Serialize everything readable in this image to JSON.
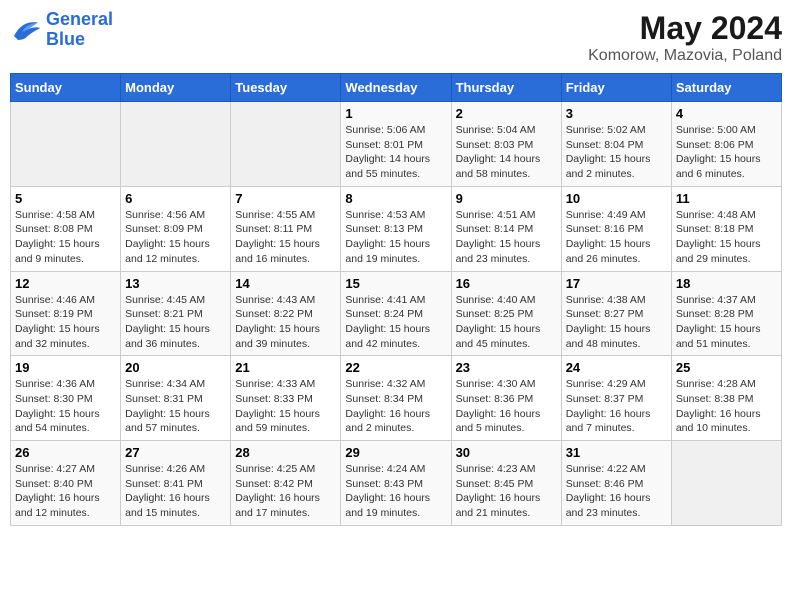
{
  "logo": {
    "line1": "General",
    "line2": "Blue"
  },
  "title": "May 2024",
  "subtitle": "Komorow, Mazovia, Poland",
  "headers": [
    "Sunday",
    "Monday",
    "Tuesday",
    "Wednesday",
    "Thursday",
    "Friday",
    "Saturday"
  ],
  "weeks": [
    [
      {
        "day": "",
        "sunrise": "",
        "sunset": "",
        "daylight": ""
      },
      {
        "day": "",
        "sunrise": "",
        "sunset": "",
        "daylight": ""
      },
      {
        "day": "",
        "sunrise": "",
        "sunset": "",
        "daylight": ""
      },
      {
        "day": "1",
        "sunrise": "Sunrise: 5:06 AM",
        "sunset": "Sunset: 8:01 PM",
        "daylight": "Daylight: 14 hours and 55 minutes."
      },
      {
        "day": "2",
        "sunrise": "Sunrise: 5:04 AM",
        "sunset": "Sunset: 8:03 PM",
        "daylight": "Daylight: 14 hours and 58 minutes."
      },
      {
        "day": "3",
        "sunrise": "Sunrise: 5:02 AM",
        "sunset": "Sunset: 8:04 PM",
        "daylight": "Daylight: 15 hours and 2 minutes."
      },
      {
        "day": "4",
        "sunrise": "Sunrise: 5:00 AM",
        "sunset": "Sunset: 8:06 PM",
        "daylight": "Daylight: 15 hours and 6 minutes."
      }
    ],
    [
      {
        "day": "5",
        "sunrise": "Sunrise: 4:58 AM",
        "sunset": "Sunset: 8:08 PM",
        "daylight": "Daylight: 15 hours and 9 minutes."
      },
      {
        "day": "6",
        "sunrise": "Sunrise: 4:56 AM",
        "sunset": "Sunset: 8:09 PM",
        "daylight": "Daylight: 15 hours and 12 minutes."
      },
      {
        "day": "7",
        "sunrise": "Sunrise: 4:55 AM",
        "sunset": "Sunset: 8:11 PM",
        "daylight": "Daylight: 15 hours and 16 minutes."
      },
      {
        "day": "8",
        "sunrise": "Sunrise: 4:53 AM",
        "sunset": "Sunset: 8:13 PM",
        "daylight": "Daylight: 15 hours and 19 minutes."
      },
      {
        "day": "9",
        "sunrise": "Sunrise: 4:51 AM",
        "sunset": "Sunset: 8:14 PM",
        "daylight": "Daylight: 15 hours and 23 minutes."
      },
      {
        "day": "10",
        "sunrise": "Sunrise: 4:49 AM",
        "sunset": "Sunset: 8:16 PM",
        "daylight": "Daylight: 15 hours and 26 minutes."
      },
      {
        "day": "11",
        "sunrise": "Sunrise: 4:48 AM",
        "sunset": "Sunset: 8:18 PM",
        "daylight": "Daylight: 15 hours and 29 minutes."
      }
    ],
    [
      {
        "day": "12",
        "sunrise": "Sunrise: 4:46 AM",
        "sunset": "Sunset: 8:19 PM",
        "daylight": "Daylight: 15 hours and 32 minutes."
      },
      {
        "day": "13",
        "sunrise": "Sunrise: 4:45 AM",
        "sunset": "Sunset: 8:21 PM",
        "daylight": "Daylight: 15 hours and 36 minutes."
      },
      {
        "day": "14",
        "sunrise": "Sunrise: 4:43 AM",
        "sunset": "Sunset: 8:22 PM",
        "daylight": "Daylight: 15 hours and 39 minutes."
      },
      {
        "day": "15",
        "sunrise": "Sunrise: 4:41 AM",
        "sunset": "Sunset: 8:24 PM",
        "daylight": "Daylight: 15 hours and 42 minutes."
      },
      {
        "day": "16",
        "sunrise": "Sunrise: 4:40 AM",
        "sunset": "Sunset: 8:25 PM",
        "daylight": "Daylight: 15 hours and 45 minutes."
      },
      {
        "day": "17",
        "sunrise": "Sunrise: 4:38 AM",
        "sunset": "Sunset: 8:27 PM",
        "daylight": "Daylight: 15 hours and 48 minutes."
      },
      {
        "day": "18",
        "sunrise": "Sunrise: 4:37 AM",
        "sunset": "Sunset: 8:28 PM",
        "daylight": "Daylight: 15 hours and 51 minutes."
      }
    ],
    [
      {
        "day": "19",
        "sunrise": "Sunrise: 4:36 AM",
        "sunset": "Sunset: 8:30 PM",
        "daylight": "Daylight: 15 hours and 54 minutes."
      },
      {
        "day": "20",
        "sunrise": "Sunrise: 4:34 AM",
        "sunset": "Sunset: 8:31 PM",
        "daylight": "Daylight: 15 hours and 57 minutes."
      },
      {
        "day": "21",
        "sunrise": "Sunrise: 4:33 AM",
        "sunset": "Sunset: 8:33 PM",
        "daylight": "Daylight: 15 hours and 59 minutes."
      },
      {
        "day": "22",
        "sunrise": "Sunrise: 4:32 AM",
        "sunset": "Sunset: 8:34 PM",
        "daylight": "Daylight: 16 hours and 2 minutes."
      },
      {
        "day": "23",
        "sunrise": "Sunrise: 4:30 AM",
        "sunset": "Sunset: 8:36 PM",
        "daylight": "Daylight: 16 hours and 5 minutes."
      },
      {
        "day": "24",
        "sunrise": "Sunrise: 4:29 AM",
        "sunset": "Sunset: 8:37 PM",
        "daylight": "Daylight: 16 hours and 7 minutes."
      },
      {
        "day": "25",
        "sunrise": "Sunrise: 4:28 AM",
        "sunset": "Sunset: 8:38 PM",
        "daylight": "Daylight: 16 hours and 10 minutes."
      }
    ],
    [
      {
        "day": "26",
        "sunrise": "Sunrise: 4:27 AM",
        "sunset": "Sunset: 8:40 PM",
        "daylight": "Daylight: 16 hours and 12 minutes."
      },
      {
        "day": "27",
        "sunrise": "Sunrise: 4:26 AM",
        "sunset": "Sunset: 8:41 PM",
        "daylight": "Daylight: 16 hours and 15 minutes."
      },
      {
        "day": "28",
        "sunrise": "Sunrise: 4:25 AM",
        "sunset": "Sunset: 8:42 PM",
        "daylight": "Daylight: 16 hours and 17 minutes."
      },
      {
        "day": "29",
        "sunrise": "Sunrise: 4:24 AM",
        "sunset": "Sunset: 8:43 PM",
        "daylight": "Daylight: 16 hours and 19 minutes."
      },
      {
        "day": "30",
        "sunrise": "Sunrise: 4:23 AM",
        "sunset": "Sunset: 8:45 PM",
        "daylight": "Daylight: 16 hours and 21 minutes."
      },
      {
        "day": "31",
        "sunrise": "Sunrise: 4:22 AM",
        "sunset": "Sunset: 8:46 PM",
        "daylight": "Daylight: 16 hours and 23 minutes."
      },
      {
        "day": "",
        "sunrise": "",
        "sunset": "",
        "daylight": ""
      }
    ]
  ]
}
